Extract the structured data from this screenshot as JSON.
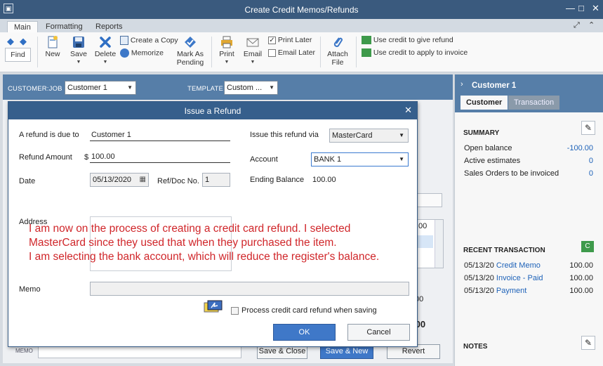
{
  "window": {
    "title": "Create Credit Memos/Refunds",
    "controls": [
      "—",
      "□",
      "✕"
    ]
  },
  "tabs": [
    {
      "label": "Main",
      "active": true
    },
    {
      "label": "Formatting"
    },
    {
      "label": "Reports"
    }
  ],
  "ribbon": {
    "find": "Find",
    "new": "New",
    "save": "Save",
    "delete": "Delete",
    "create_copy": "Create a Copy",
    "memorize": "Memorize",
    "mark_as_pending_1": "Mark As",
    "mark_as_pending_2": "Pending",
    "print": "Print",
    "email": "Email",
    "print_later": "Print Later",
    "email_later": "Email Later",
    "attach_1": "Attach",
    "attach_2": "File",
    "credit_refund": "Use credit to give refund",
    "credit_invoice": "Use credit to apply to invoice"
  },
  "form_header": {
    "customer_job_label": "CUSTOMER:JOB",
    "customer_job_value": "Customer 1",
    "template_label": "TEMPLATE",
    "template_value": "Custom ..."
  },
  "background": {
    "amount_1": ".00",
    "amount_2": ".00",
    "total": ".00",
    "memo_label": "MEMO",
    "save_close": "Save & Close",
    "save_new": "Save & New",
    "revert": "Revert"
  },
  "right_panel": {
    "customer_name": "Customer 1",
    "tab_customer": "Customer",
    "tab_transaction": "Transaction",
    "summary_title": "SUMMARY",
    "summary": [
      {
        "label": "Open balance",
        "value": "-100.00"
      },
      {
        "label": "Active estimates",
        "value": "0"
      },
      {
        "label": "Sales Orders to be invoiced",
        "value": "0"
      }
    ],
    "recent_title": "RECENT TRANSACTION",
    "recent": [
      {
        "date": "05/13/20",
        "type": "Credit Memo",
        "status": "",
        "amount": "100.00"
      },
      {
        "date": "05/13/20",
        "type": "Invoice",
        "status": " - Paid",
        "amount": "100.00"
      },
      {
        "date": "05/13/20",
        "type": "Payment",
        "status": "",
        "amount": "100.00"
      }
    ],
    "notes_title": "NOTES"
  },
  "dialog": {
    "title": "Issue a Refund",
    "refund_due_label": "A refund is due to",
    "refund_due_value": "Customer 1",
    "refund_amount_label": "Refund Amount",
    "currency": "$",
    "refund_amount_value": "100.00",
    "date_label": "Date",
    "date_value": "05/13/2020",
    "refdoc_label": "Ref/Doc No.",
    "refdoc_value": "1",
    "issue_via_label": "Issue this refund via",
    "issue_via_value": "MasterCard",
    "account_label": "Account",
    "account_value": "BANK 1",
    "ending_balance_label": "Ending Balance",
    "ending_balance_value": "100.00",
    "address_label": "Address",
    "memo_label": "Memo",
    "process_cc_label": "Process credit card refund when saving",
    "ok": "OK",
    "cancel": "Cancel"
  },
  "annotation": {
    "line1": "I am now on the process of creating a credit card refund. I selected",
    "line2": "MasterCard since they used that when they purchased the item.",
    "line3": "I am selecting the bank account, which will reduce the register's balance."
  },
  "colors": {
    "titlebar": "#3a5a7e",
    "header_band": "#567ea8",
    "link": "#1e62b8",
    "annotation": "#d0262a",
    "ok_button": "#3f78c8"
  }
}
